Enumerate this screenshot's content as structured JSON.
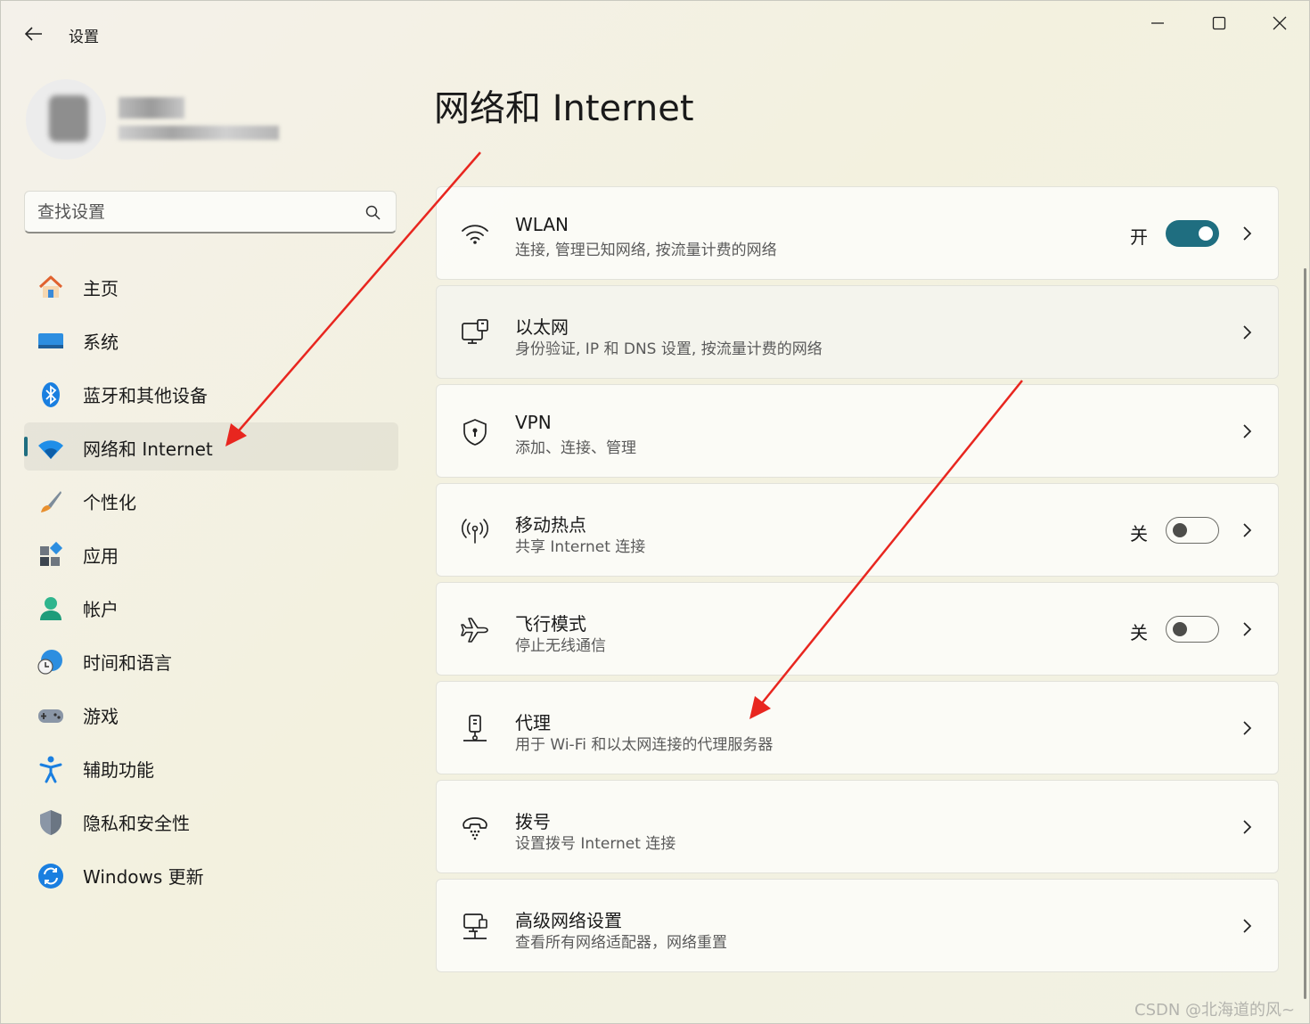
{
  "window": {
    "title": "设置"
  },
  "search": {
    "placeholder": "查找设置"
  },
  "nav": [
    {
      "label": "主页",
      "icon": "home-icon"
    },
    {
      "label": "系统",
      "icon": "system-icon"
    },
    {
      "label": "蓝牙和其他设备",
      "icon": "bluetooth-icon"
    },
    {
      "label": "网络和 Internet",
      "icon": "wifi-icon",
      "active": true
    },
    {
      "label": "个性化",
      "icon": "brush-icon"
    },
    {
      "label": "应用",
      "icon": "apps-icon"
    },
    {
      "label": "帐户",
      "icon": "account-icon"
    },
    {
      "label": "时间和语言",
      "icon": "globe-clock-icon"
    },
    {
      "label": "游戏",
      "icon": "gamepad-icon"
    },
    {
      "label": "辅助功能",
      "icon": "accessibility-icon"
    },
    {
      "label": "隐私和安全性",
      "icon": "shield-icon"
    },
    {
      "label": "Windows 更新",
      "icon": "update-icon"
    }
  ],
  "main": {
    "title": "网络和 Internet",
    "cards": [
      {
        "title": "WLAN",
        "desc": "连接, 管理已知网络, 按流量计费的网络",
        "toggle": "开",
        "icon": "wifi-icon"
      },
      {
        "title": "以太网",
        "desc": "身份验证, IP 和 DNS 设置, 按流量计费的网络",
        "icon": "ethernet-icon"
      },
      {
        "title": "VPN",
        "desc": "添加、连接、管理",
        "icon": "vpn-shield-icon"
      },
      {
        "title": "移动热点",
        "desc": "共享 Internet 连接",
        "toggle": "关",
        "icon": "hotspot-icon"
      },
      {
        "title": "飞行模式",
        "desc": "停止无线通信",
        "toggle": "关",
        "icon": "airplane-icon"
      },
      {
        "title": "代理",
        "desc": "用于 Wi-Fi 和以太网连接的代理服务器",
        "icon": "proxy-icon"
      },
      {
        "title": "拨号",
        "desc": "设置拨号 Internet 连接",
        "icon": "dialup-icon"
      },
      {
        "title": "高级网络设置",
        "desc": "查看所有网络适配器，网络重置",
        "icon": "advanced-network-icon"
      }
    ]
  },
  "colors": {
    "accent": "#1f6e80",
    "arrow": "#e8261f"
  },
  "watermark": "CSDN @北海道的风~"
}
